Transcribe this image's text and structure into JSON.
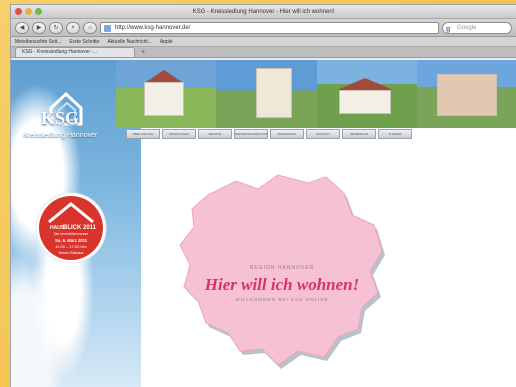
{
  "window": {
    "title": "KSG - Kreissiedlung Hannover - Hier will ich wohnen!"
  },
  "toolbar": {
    "url": "http://www.ksg-hannover.de/",
    "search_placeholder": "Google"
  },
  "bookmarks": {
    "items": [
      "Meistbesuchte Seit...",
      "Erste Schritte",
      "Aktuelle Nachricht...",
      "Apple"
    ]
  },
  "tabs": {
    "active": "KSG - Kreissiedlung Hannover -..."
  },
  "site": {
    "logo_text": "KSG",
    "logo_sub": "Kreissiedlung Hannover",
    "nav": [
      "ÜBER DIE KSG",
      "WOHNUNGEN",
      "SERVICE",
      "MIETERINFORMATION",
      "MIETERFEST",
      "KONTAKT",
      "IMPRESSUM",
      "SITEMAP"
    ],
    "badge": {
      "top": "HAUS",
      "title": "BLICK 2011",
      "subtitle": "Die Immobilienmesse",
      "date": "So, 6. März 2011",
      "time": "11:00 – 17:00 Uhr",
      "place": "Neues Rathaus"
    },
    "map": {
      "region": "REGION HANNOVER",
      "headline": "Hier will ich wohnen!",
      "welcome": "WILLKOMMEN BEI KSG-ONLINE"
    }
  },
  "colors": {
    "accent_pink": "#d6336c",
    "map_pink": "#f6c2d3",
    "sky_blue": "#7eb7df"
  }
}
